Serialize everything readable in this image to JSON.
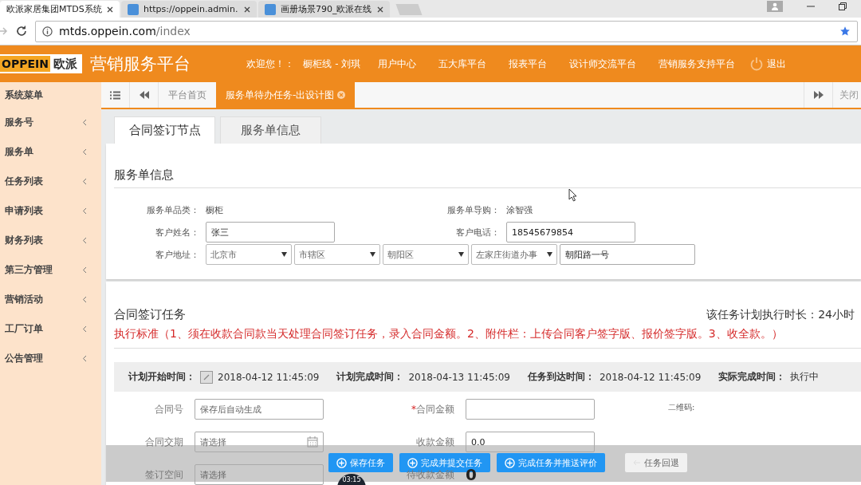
{
  "browser": {
    "tabs": [
      {
        "title": "欧派家居集团MTDS系统",
        "selected": true,
        "has_favicon": false
      },
      {
        "title": "https://oppein.admin.",
        "selected": false,
        "has_favicon": true
      },
      {
        "title": "画册场景790_欧派在线",
        "selected": false,
        "has_favicon": true
      }
    ],
    "url_host": "mtds.oppein.com",
    "url_path": "/index"
  },
  "header": {
    "logo_text": "OPPEIN",
    "logo_cn": "欧派",
    "title": "营销服务平台",
    "greeting": "欢迎您！：",
    "user": "橱柜线 - 刘琪",
    "nav": [
      "用户中心",
      "五大库平台",
      "报表平台",
      "设计师交流平台",
      "营销服务支持平台"
    ],
    "logout": "退出"
  },
  "sidebar": {
    "items": [
      {
        "label": "系统菜单",
        "kind": "header"
      },
      {
        "label": "服务号",
        "kind": "menu"
      },
      {
        "label": "服务单",
        "kind": "menu"
      },
      {
        "label": "任务列表",
        "kind": "menu"
      },
      {
        "label": "申请列表",
        "kind": "menu"
      },
      {
        "label": "财务列表",
        "kind": "menu"
      },
      {
        "label": "第三方管理",
        "kind": "menu"
      },
      {
        "label": "营销活动",
        "kind": "menu"
      },
      {
        "label": "工厂订单",
        "kind": "menu"
      },
      {
        "label": "公告管理",
        "kind": "menu"
      }
    ]
  },
  "page_tabs": {
    "items": [
      {
        "label": "平台首页",
        "selected": false,
        "closable": false
      },
      {
        "label": "服务单待办任务-出设计图",
        "selected": true,
        "closable": true
      }
    ],
    "close_label": "关闭"
  },
  "subtabs": [
    {
      "label": "合同签订节点",
      "selected": true
    },
    {
      "label": "服务单信息",
      "selected": false
    }
  ],
  "service_info": {
    "title": "服务单信息",
    "category_label": "服务单品类：",
    "category": "橱柜",
    "guide_label": "服务单导购：",
    "guide": "涂智强",
    "name_label": "客户姓名：",
    "name": "张三",
    "phone_label": "客户电话：",
    "phone": "18545679854",
    "address_label": "客户地址：",
    "address_selects": [
      "北京市",
      "市辖区",
      "朝阳区",
      "左家庄街道办事"
    ],
    "address_detail": "朝阳路一号"
  },
  "task": {
    "title": "合同签订任务",
    "duration": "该任务计划执行时长：24小时",
    "standard": "执行标准（1、须在收款合同款当天处理合同签订任务，录入合同金额。2、附件栏：上传合同客户签字版、报价签字版。3、收全款。）",
    "times": [
      {
        "label": "计划开始时间：",
        "value": "2018-04-12 11:45:09",
        "has_icon": true
      },
      {
        "label": "计划完成时间：",
        "value": "2018-04-13 11:45:09",
        "has_icon": false
      },
      {
        "label": "任务到达时间：",
        "value": "2018-04-12 11:45:09",
        "has_icon": false
      },
      {
        "label": "实际完成时间：",
        "value": "执行中",
        "has_icon": false
      }
    ],
    "required_mark": "*",
    "field_rows": [
      [
        {
          "label": "合同号",
          "kind": "input",
          "placeholder": "保存后自动生成",
          "required": false
        },
        {
          "label": "合同金额",
          "kind": "input",
          "required": true
        },
        {
          "label": "二维码:",
          "kind": "static",
          "required": false
        }
      ],
      [
        {
          "label": "合同交期",
          "kind": "date",
          "placeholder": "请选择",
          "required": false
        },
        {
          "label": "收款金额",
          "kind": "input",
          "value": "0.0",
          "required": false
        }
      ],
      [
        {
          "label": "签订空间",
          "kind": "input",
          "placeholder": "请选择",
          "required": false
        },
        {
          "label": "待收款金额",
          "kind": "amount",
          "value": "0",
          "required": false
        }
      ]
    ]
  },
  "actions": [
    {
      "label": "保存任务",
      "kind": "primary"
    },
    {
      "label": "完成并提交任务",
      "kind": "primary"
    },
    {
      "label": "完成任务并推送评价",
      "kind": "primary"
    },
    {
      "label": "任务回退",
      "kind": "default"
    }
  ],
  "recorder": {
    "time": "03:15"
  }
}
